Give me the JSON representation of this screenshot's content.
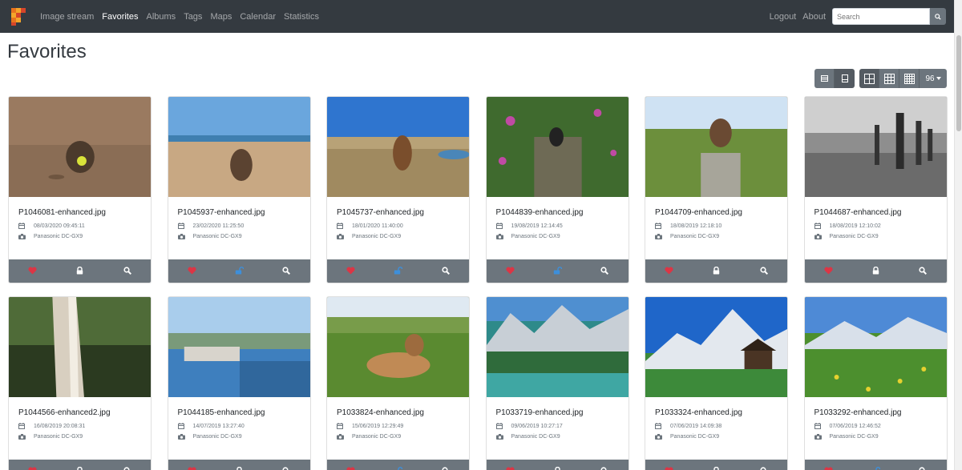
{
  "nav": {
    "links": [
      "Image stream",
      "Favorites",
      "Albums",
      "Tags",
      "Maps",
      "Calendar",
      "Statistics"
    ],
    "active_index": 1,
    "logout": "Logout",
    "about": "About",
    "search_placeholder": "Search"
  },
  "page": {
    "title": "Favorites"
  },
  "toolbar": {
    "per_page": "96"
  },
  "colors": {
    "navbar": "#343a40",
    "heart": "#dc3545",
    "unlock": "#3d8fdb",
    "action_bar": "#6c757d"
  },
  "photos": [
    {
      "filename": "P1046081-enhanced.jpg",
      "date": "08/03/2020 09:45:11",
      "camera": "Panasonic DC-GX9",
      "lock": "locked"
    },
    {
      "filename": "P1045937-enhanced.jpg",
      "date": "23/02/2020 11:25:50",
      "camera": "Panasonic DC-GX9",
      "lock": "unlocked"
    },
    {
      "filename": "P1045737-enhanced.jpg",
      "date": "18/01/2020 11:40:00",
      "camera": "Panasonic DC-GX9",
      "lock": "unlocked"
    },
    {
      "filename": "P1044839-enhanced.jpg",
      "date": "19/08/2019 12:14:45",
      "camera": "Panasonic DC-GX9",
      "lock": "unlocked"
    },
    {
      "filename": "P1044709-enhanced.jpg",
      "date": "18/08/2019 12:18:10",
      "camera": "Panasonic DC-GX9",
      "lock": "locked"
    },
    {
      "filename": "P1044687-enhanced.jpg",
      "date": "18/08/2019 12:10:02",
      "camera": "Panasonic DC-GX9",
      "lock": "locked"
    },
    {
      "filename": "P1044566-enhanced2.jpg",
      "date": "16/08/2019 20:08:31",
      "camera": "Panasonic DC-GX9",
      "lock": "locked"
    },
    {
      "filename": "P1044185-enhanced.jpg",
      "date": "14/07/2019 13:27:40",
      "camera": "Panasonic DC-GX9",
      "lock": "locked"
    },
    {
      "filename": "P1033824-enhanced.jpg",
      "date": "15/06/2019 12:29:49",
      "camera": "Panasonic DC-GX9",
      "lock": "unlocked"
    },
    {
      "filename": "P1033719-enhanced.jpg",
      "date": "09/06/2019 10:27:17",
      "camera": "Panasonic DC-GX9",
      "lock": "locked"
    },
    {
      "filename": "P1033324-enhanced.jpg",
      "date": "07/06/2019 14:09:38",
      "camera": "Panasonic DC-GX9",
      "lock": "locked"
    },
    {
      "filename": "P1033292-enhanced.jpg",
      "date": "07/06/2019 12:46:52",
      "camera": "Panasonic DC-GX9",
      "lock": "unlocked"
    }
  ]
}
